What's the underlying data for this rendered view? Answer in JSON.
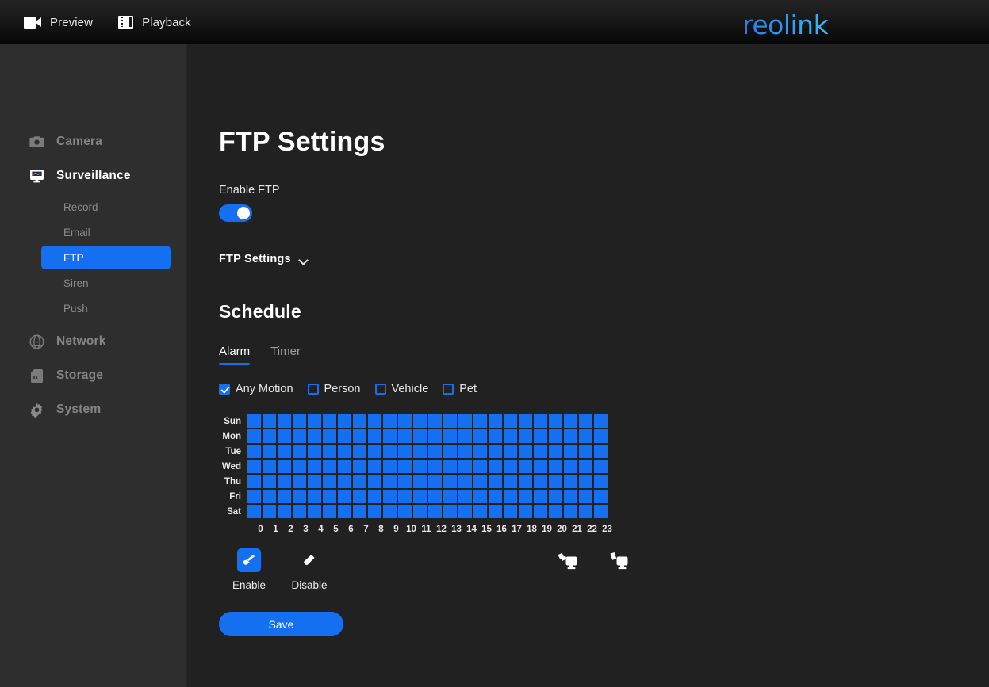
{
  "topbar": {
    "items": [
      {
        "label": "Preview",
        "icon": "camcorder-icon"
      },
      {
        "label": "Playback",
        "icon": "film-strip-icon"
      }
    ],
    "logo": "reolink"
  },
  "sidebar": {
    "items": [
      {
        "label": "Camera",
        "icon": "camera-icon",
        "active": false
      },
      {
        "label": "Surveillance",
        "icon": "monitor-icon",
        "active": true
      },
      {
        "label": "Network",
        "icon": "globe-icon",
        "active": false
      },
      {
        "label": "Storage",
        "icon": "sdcard-icon",
        "active": false
      },
      {
        "label": "System",
        "icon": "gear-icon",
        "active": false
      }
    ],
    "sub_items": [
      {
        "label": "Record",
        "active": false
      },
      {
        "label": "Email",
        "active": false
      },
      {
        "label": "FTP",
        "active": true
      },
      {
        "label": "Siren",
        "active": false
      },
      {
        "label": "Push",
        "active": false
      }
    ]
  },
  "main": {
    "page_title": "FTP Settings",
    "enable_ftp_label": "Enable FTP",
    "enable_ftp_on": true,
    "collapse_label": "FTP Settings",
    "collapse_icon": "chevron-down-icon",
    "schedule_title": "Schedule",
    "tabs": [
      {
        "label": "Alarm",
        "active": true
      },
      {
        "label": "Timer",
        "active": false
      }
    ],
    "filters": [
      {
        "label": "Any Motion",
        "checked": true
      },
      {
        "label": "Person",
        "checked": false
      },
      {
        "label": "Vehicle",
        "checked": false
      },
      {
        "label": "Pet",
        "checked": false
      }
    ],
    "schedule": {
      "days": [
        "Sun",
        "Mon",
        "Tue",
        "Wed",
        "Thu",
        "Fri",
        "Sat"
      ],
      "hours": [
        "0",
        "1",
        "2",
        "3",
        "4",
        "5",
        "6",
        "7",
        "8",
        "9",
        "10",
        "11",
        "12",
        "13",
        "14",
        "15",
        "16",
        "17",
        "18",
        "19",
        "20",
        "21",
        "22",
        "23"
      ],
      "enabled_cells": [
        [
          1,
          1,
          1,
          1,
          1,
          1,
          1,
          1,
          1,
          1,
          1,
          1,
          1,
          1,
          1,
          1,
          1,
          1,
          1,
          1,
          1,
          1,
          1,
          1
        ],
        [
          1,
          1,
          1,
          1,
          1,
          1,
          1,
          1,
          1,
          1,
          1,
          1,
          1,
          1,
          1,
          1,
          1,
          1,
          1,
          1,
          1,
          1,
          1,
          1
        ],
        [
          1,
          1,
          1,
          1,
          1,
          1,
          1,
          1,
          1,
          1,
          1,
          1,
          1,
          1,
          1,
          1,
          1,
          1,
          1,
          1,
          1,
          1,
          1,
          1
        ],
        [
          1,
          1,
          1,
          1,
          1,
          1,
          1,
          1,
          1,
          1,
          1,
          1,
          1,
          1,
          1,
          1,
          1,
          1,
          1,
          1,
          1,
          1,
          1,
          1
        ],
        [
          1,
          1,
          1,
          1,
          1,
          1,
          1,
          1,
          1,
          1,
          1,
          1,
          1,
          1,
          1,
          1,
          1,
          1,
          1,
          1,
          1,
          1,
          1,
          1
        ],
        [
          1,
          1,
          1,
          1,
          1,
          1,
          1,
          1,
          1,
          1,
          1,
          1,
          1,
          1,
          1,
          1,
          1,
          1,
          1,
          1,
          1,
          1,
          1,
          1
        ],
        [
          1,
          1,
          1,
          1,
          1,
          1,
          1,
          1,
          1,
          1,
          1,
          1,
          1,
          1,
          1,
          1,
          1,
          1,
          1,
          1,
          1,
          1,
          1,
          1
        ]
      ]
    },
    "tools": [
      {
        "label": "Enable",
        "icon": "brush-icon",
        "selected": true
      },
      {
        "label": "Disable",
        "icon": "eraser-icon",
        "selected": false
      }
    ],
    "bulk_tools": [
      {
        "icon": "select-all-brush-icon"
      },
      {
        "icon": "clear-all-eraser-icon"
      }
    ],
    "save_label": "Save"
  },
  "colors": {
    "accent": "#1470f0",
    "sidebar_bg": "#2e2e2e",
    "main_bg": "#212121",
    "topbar_bg": "#151515",
    "cell_off": "#3a3a3a"
  }
}
